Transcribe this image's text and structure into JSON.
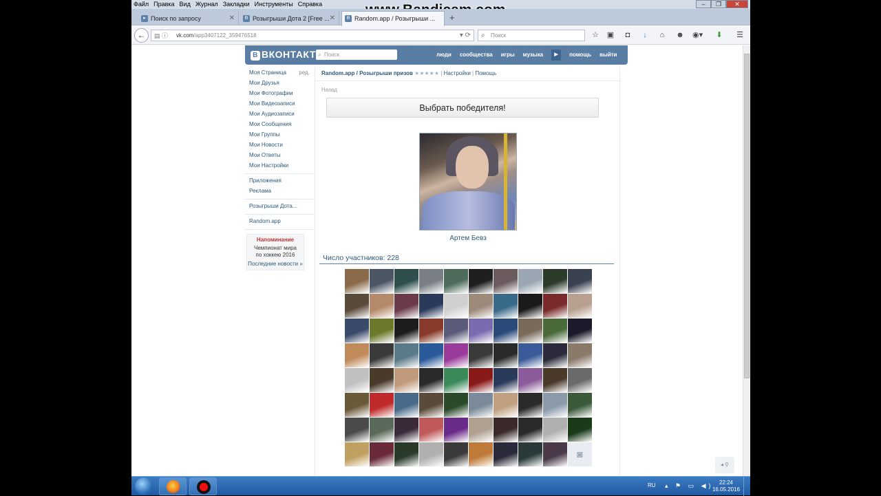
{
  "browser": {
    "menu": [
      "Файл",
      "Правка",
      "Вид",
      "Журнал",
      "Закладки",
      "Инструменты",
      "Справка"
    ],
    "watermark": "www.Bandicam.com",
    "tabs": [
      {
        "label": "Поиск по запросу"
      },
      {
        "label": "Розыгрыши Дота 2 [Free ..."
      },
      {
        "label": "Random.app / Розыгрыши ..."
      }
    ],
    "url_domain": "vk.com",
    "url_path": "/app3407122_359476518",
    "search_placeholder": "Поиск"
  },
  "vk": {
    "logo": "ВКОНТАКТЕ",
    "logo_badge": "В",
    "search_placeholder": "Поиск",
    "nav": [
      "люди",
      "сообщества",
      "игры",
      "музыка",
      "помощь",
      "выйти"
    ],
    "left_menu": [
      {
        "label": "Моя Страница"
      },
      {
        "label": "Мои Друзья"
      },
      {
        "label": "Мои Фотографии"
      },
      {
        "label": "Мои Видеозаписи"
      },
      {
        "label": "Мои Аудиозаписи"
      },
      {
        "label": "Мои Сообщения"
      },
      {
        "label": "Мои Группы"
      },
      {
        "label": "Мои Новости"
      },
      {
        "label": "Мои Ответы"
      },
      {
        "label": "Мои Настройки"
      }
    ],
    "edit_label": "ред.",
    "left_extra": [
      {
        "label": "Приложения"
      },
      {
        "label": "Реклама"
      }
    ],
    "left_app1": "Розыгрыши Дота...",
    "left_app2": "Random.app",
    "reminder": {
      "title": "Напоминание",
      "line1": "Чемпионат мира",
      "line2": "по хоккею 2016",
      "link": "Последние новости »"
    }
  },
  "app": {
    "title": "Random.app / Розыгрыши призов",
    "stars": "★★★★★",
    "settings": "Настройки",
    "help": "Помощь",
    "back": "Назад",
    "pick_winner": "Выбрать победителя!",
    "winner_name": "Артем Бевз",
    "participants_label": "Число участников: 228",
    "avatar_colors": [
      "#8a6a4a",
      "#4b5563",
      "#2f4f4f",
      "#7a7f86",
      "#4e6b5c",
      "#1f1f1f",
      "#6b5b5e",
      "#9aa7b3",
      "#2d3b2b",
      "#3a4150",
      "#5a4a3a",
      "#b58a6a",
      "#6a3a4a",
      "#2a3a5a",
      "#d0d0d0",
      "#9c8a7a",
      "#3a6a8a",
      "#1a1a1a",
      "#7a2a2a",
      "#b8a090",
      "#3a4a6a",
      "#6a7a2a",
      "#1c1c1c",
      "#8a3a2a",
      "#5a5a7a",
      "#7a6ab0",
      "#2a4a7a",
      "#7a6a5a",
      "#4a6a3a",
      "#1a1a2a",
      "#c08a5a",
      "#3a3a3a",
      "#5a7a8a",
      "#2a5a9a",
      "#9a3a9a",
      "#3a3a3a",
      "#2a2a2a",
      "#3a5a9a",
      "#2a2a3a",
      "#8a7a6a",
      "#c0c0c0",
      "#4a3a2a",
      "#c09a7a",
      "#2a2a2a",
      "#3a8a5a",
      "#8a1a1a",
      "#2a3a5a",
      "#8a5a9a",
      "#4a3a2a",
      "#6a6a6a",
      "#6a5a3a",
      "#c02a2a",
      "#4a6a8a",
      "#5a4a3a",
      "#2a4a2a",
      "#7a8a9a",
      "#c0a080",
      "#2a2a2a",
      "#8a9aaa",
      "#3a5a3a",
      "#4a4a4a",
      "#5a6a5a",
      "#3a2a3a",
      "#c05a5a",
      "#6a2a8a",
      "#b0a090",
      "#3a2a2a",
      "#2a2a2a",
      "#b0b0b0",
      "#1a3a1a",
      "#c0a060",
      "#6a2a3a",
      "#2a3a2a",
      "#b0b0b0",
      "#3a3a3a",
      "#c07a3a",
      "#2a2a3a",
      "#2a3a3a",
      "#4a3a4a",
      "cam"
    ]
  }
}
